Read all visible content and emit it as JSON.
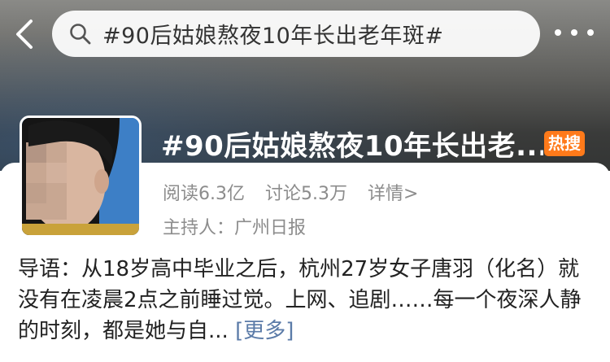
{
  "header": {
    "search_text": "#90后姑娘熬夜10年长出老年斑#",
    "back_icon": "chevron-left-icon",
    "search_icon": "search-icon",
    "more_icon": "more-dots-icon"
  },
  "topic": {
    "title": "#90后姑娘熬夜10年长出老...",
    "badge": "热搜",
    "reads": "阅读6.3亿",
    "discussions": "讨论5.3万",
    "detail_link": "详情>",
    "host": "主持人：广州日报",
    "intro_text": "导语：从18岁高中毕业之后，杭州27岁女子唐羽（化名）就没有在凌晨2点之前睡过觉。上网、追剧……每一个夜深人静的时刻，都是她与自... ",
    "intro_more": "[更多]"
  },
  "colors": {
    "badge_bg": "#ff7a1a",
    "link": "#5b7ba8",
    "meta_text": "#8c8c8c"
  }
}
